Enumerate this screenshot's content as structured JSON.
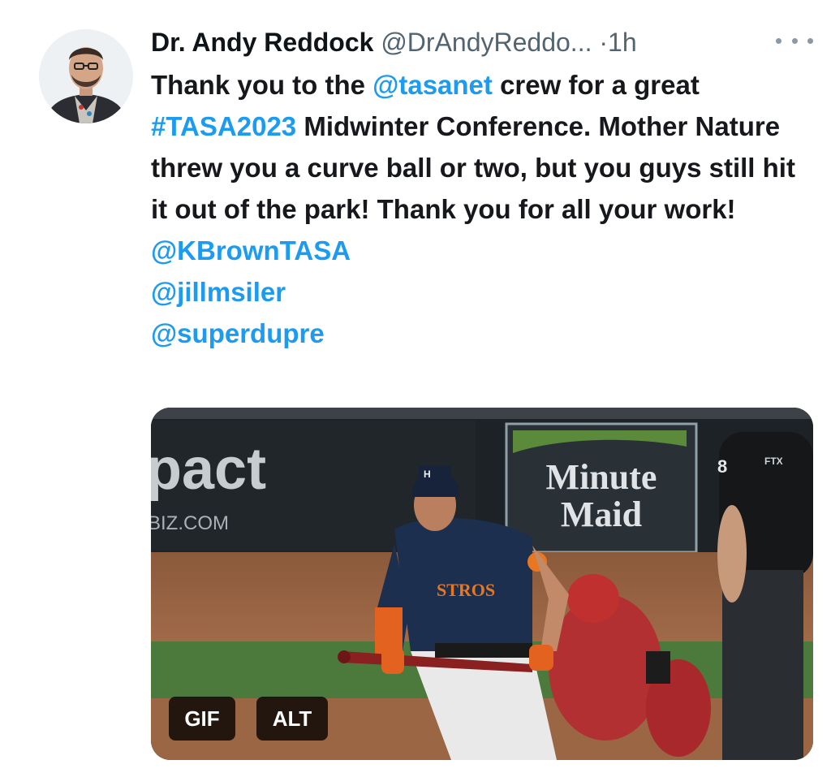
{
  "tweet": {
    "author_name": "Dr. Andy Reddock",
    "author_handle": "@DrAndyReddo...",
    "separator": "·",
    "time": "1h",
    "text": {
      "p1": "Thank you to the ",
      "mention_main": "@tasanet",
      "p2": " crew for a great ",
      "hashtag": "#TASA2023",
      "p3": " Midwinter Conference. Mother Nature threw you a curve ball or two, but you guys still hit it out of the park! Thank you for all your work!",
      "mentions": [
        "@KBrownTASA",
        "@jillmsiler",
        "@superdupre"
      ]
    },
    "media": {
      "badge_gif": "GIF",
      "badge_alt": "ALT",
      "scene_text": {
        "sign_left_big": "pact",
        "sign_left_small": "BIZ.COM",
        "sign_right_line1": "Minute",
        "sign_right_line2": "Maid",
        "jersey": "STROS",
        "umpire_number": "8",
        "umpire_patch": "FTX"
      }
    }
  },
  "colors": {
    "link": "#1d9bf0",
    "text": "#0f1419",
    "muted": "#536471"
  }
}
